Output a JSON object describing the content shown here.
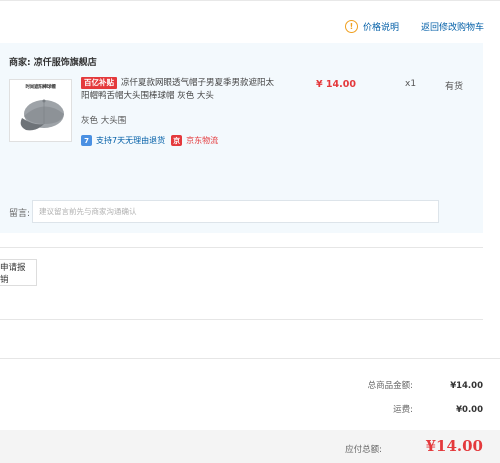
{
  "header": {
    "price_note": "价格说明",
    "back_to_cart": "返回修改购物车"
  },
  "shop": {
    "merchant_label": "商家: 凉仟服饰旗舰店",
    "product": {
      "thumb_banner": "时尚遮阳棒球帽",
      "subsidy_badge": "百亿补贴",
      "title": "凉仟夏款网眼透气帽子男夏季男款遮阳太阳帽鸭舌帽大头围棒球帽 灰色 大头",
      "spec": "灰色 大头围",
      "service_return": "支持7天无理由退货",
      "service_logistics": "京东物流",
      "price": "¥ 14.00",
      "quantity": "x1",
      "stock": "有货"
    },
    "message_label": "留言:",
    "message_placeholder": "建议留言前先与商家沟通确认"
  },
  "invoice": {
    "button_label": "申请报销"
  },
  "summary": {
    "goods_total_label": "总商品金额:",
    "goods_total_value": "¥14.00",
    "shipping_label": "运费:",
    "shipping_value": "¥0.00",
    "payable_label": "应付总额:",
    "payable_value": "¥14.00"
  },
  "colors": {
    "accent_red": "#e4393c",
    "link_blue": "#005ea7",
    "panel_bg": "#f3f9fd",
    "warn_orange": "#f0a020"
  },
  "icons": [
    "warning-icon",
    "return-policy-icon",
    "jd-logistics-icon",
    "cap-product-image"
  ]
}
